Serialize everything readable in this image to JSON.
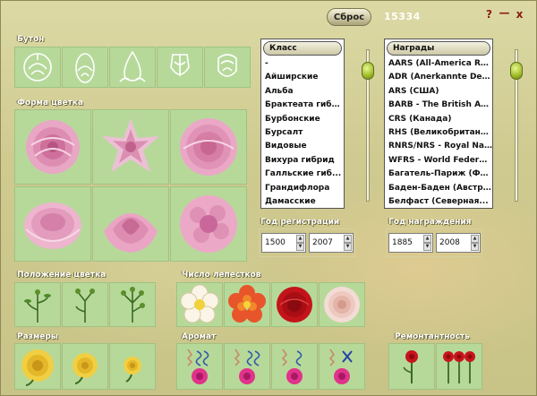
{
  "toolbar": {
    "reset_label": "Сброс",
    "count": "15334"
  },
  "window_controls": {
    "help": "?",
    "minimize": "—",
    "close": "x"
  },
  "sections": {
    "bud": "Бутон",
    "flower_shape": "Форма цветка",
    "class": "Класс",
    "awards": "Награды",
    "reg_year": "Год регистрации",
    "award_year": "Год награждения",
    "flower_position": "Положение цветка",
    "petal_count": "Число лепестков",
    "size": "Размеры",
    "aroma": "Аромат",
    "remontancy": "Ремонтантность"
  },
  "class_list": {
    "items": [
      "-",
      "Айширские",
      "Альба",
      "Брактеата гибрид",
      "Бурбонские",
      "Бурсалт",
      "Видовые",
      "Вихура гибрид",
      "Галльские гиб...",
      "Грандифлора",
      "Дамасские"
    ]
  },
  "awards_list": {
    "items": [
      "AARS (All-America Ro...",
      "ADR (Anerkannte Deut...",
      "ARS (США)",
      "BARB - The British Ass...",
      "CRS (Канада)",
      "RHS (Великобритания)",
      "RNRS/NRS - Royal Nat...",
      "WFRS - World Federat...",
      "Багатель-Париж (Фр...",
      "Баден-Баден (Австрия)",
      "Белфаст (Северная..."
    ]
  },
  "reg_year": {
    "from": "1500",
    "to": "2007"
  },
  "award_year": {
    "from": "1885",
    "to": "2008"
  },
  "colors": {
    "tile": "#b6d99a",
    "accent": "#8b1a10",
    "knob": "#9fbd28"
  }
}
